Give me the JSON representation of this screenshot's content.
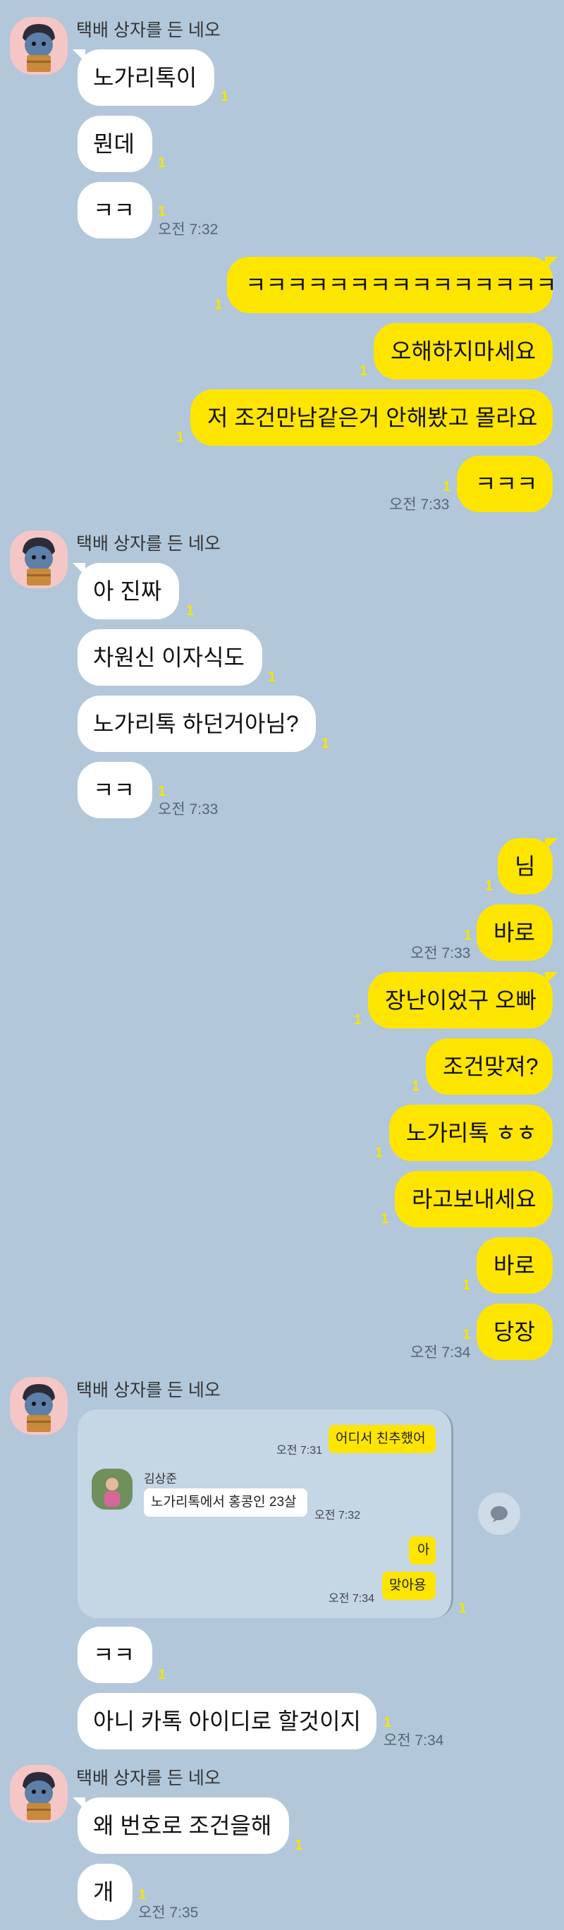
{
  "sender_name": "택배 상자를 든 네오",
  "unread": "1",
  "messages": {
    "m1": "노가리톡이",
    "m2": "뭔데",
    "m3": "ㅋㅋ",
    "t1": "오전 7:32",
    "r1": "ㅋㅋㅋㅋㅋㅋㅋㅋㅋㅋㅋㅋㅋㅋㅋ",
    "r2": "오해하지마세요",
    "r3": "저 조건만남같은거 안해봤고 몰라요",
    "r4": "ㅋㅋㅋ",
    "t2": "오전 7:33",
    "m4": "아 진짜",
    "m5": "차원신 이자식도",
    "m6": "노가리톡 하던거아님?",
    "m7": "ㅋㅋ",
    "t3": "오전 7:33",
    "r5": "님",
    "r6": "바로",
    "t4": "오전 7:33",
    "r7": "장난이었구 오빠",
    "r8": "조건맞져?",
    "r9": "노가리톡 ㅎㅎ",
    "r10": "라고보내세요",
    "r11": "바로",
    "r12": "당장",
    "t5": "오전 7:34",
    "m8": "ㅋㅋ",
    "m9": "아니 카톡 아이디로 할것이지",
    "t6": "오전 7:34",
    "m10": "왜 번호로 조건을해",
    "m11": "개",
    "t7": "오전 7:35"
  },
  "embedded": {
    "b1": "어디서 친추했어",
    "b1_time": "오전 7:31",
    "name": "김상준",
    "b2": "노가리톡에서  홍콩인 23살",
    "b2_time": "오전 7:32",
    "b3": "아",
    "b4": "맞아용",
    "b4_time": "오전 7:34"
  },
  "colors": {
    "background": "#b2c7da",
    "outgoing_bubble": "#fee500",
    "incoming_bubble": "#ffffff",
    "unread_count": "#f6e600"
  }
}
